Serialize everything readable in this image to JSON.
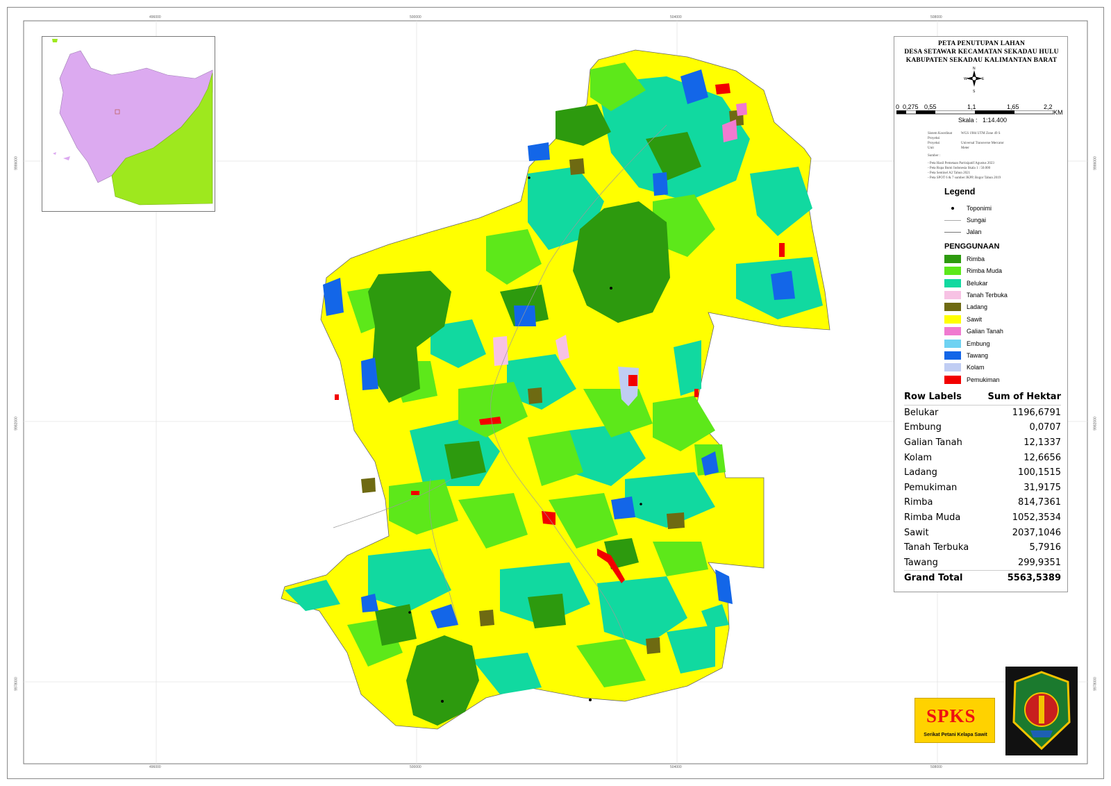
{
  "map": {
    "title_lines": [
      "PETA PENUTUPAN LAHAN",
      "DESA SETAWAR KECAMATAN SEKADAU HULU",
      "KABUPATEN SEKADAU KALIMANTAN BARAT"
    ],
    "north_arrow": {
      "n": "N",
      "s": "S",
      "e": "E",
      "w": "W"
    },
    "scale_labels": [
      "0",
      "0,275",
      "0,55",
      "1,1",
      "1,65",
      "2,2"
    ],
    "scale_unit": "KM",
    "scale_text": "Skala :",
    "scale_value": "1:14.400",
    "coordinate_system": [
      {
        "k": "Sistem Koordinat Proyeksi",
        "v": "WGS 1984 UTM Zone 49 S"
      },
      {
        "k": "Proyeksi",
        "v": "Universal Transverse Mercator"
      },
      {
        "k": "Unit",
        "v": "Meter"
      }
    ],
    "sources_title": "Sumber :",
    "sources": [
      "- Peta Hasil Pemetaan Partisipatif Agustus 2023",
      "- Peta Rupa Bumi Indonesia Skala 1 : 50.000",
      "- Peta Sentinel A2 Tahun 2021",
      "- Peta SPOT 6 & 7 sumber JKPP, Bogor Tahun 2019"
    ],
    "grid_labels_top": [
      "496000",
      "500000",
      "504000",
      "508000"
    ],
    "grid_labels_side": [
      "9986000",
      "9982000",
      "9978000"
    ]
  },
  "legend": {
    "title": "Legend",
    "symbols": [
      {
        "label": "Toponimi",
        "icon": "point-icon"
      },
      {
        "label": "Sungai",
        "icon": "river-line-icon"
      },
      {
        "label": "Jalan",
        "icon": "road-line-icon"
      }
    ],
    "section_title": "PENGGUNAAN",
    "classes": [
      {
        "label": "Rimba",
        "color": "#2d9a0e"
      },
      {
        "label": "Rimba Muda",
        "color": "#5de81a"
      },
      {
        "label": "Belukar",
        "color": "#11d9a0"
      },
      {
        "label": "Tanah Terbuka",
        "color": "#f7c2e4"
      },
      {
        "label": "Ladang",
        "color": "#6e6a12"
      },
      {
        "label": "Sawit",
        "color": "#ffff00"
      },
      {
        "label": "Galian Tanah",
        "color": "#f07ad0"
      },
      {
        "label": "Embung",
        "color": "#6fd2f2"
      },
      {
        "label": "Tawang",
        "color": "#1366e8"
      },
      {
        "label": "Kolam",
        "color": "#c0cdf3"
      },
      {
        "label": "Pemukiman",
        "color": "#f20000"
      }
    ]
  },
  "stats": {
    "header": {
      "label": "Row Labels",
      "value": "Sum of Hektar"
    },
    "rows": [
      {
        "label": "Belukar",
        "value": "1196,6791"
      },
      {
        "label": "Embung",
        "value": "0,0707"
      },
      {
        "label": "Galian Tanah",
        "value": "12,1337"
      },
      {
        "label": "Kolam",
        "value": "12,6656"
      },
      {
        "label": "Ladang",
        "value": "100,1515"
      },
      {
        "label": "Pemukiman",
        "value": "31,9175"
      },
      {
        "label": "Rimba",
        "value": "814,7361"
      },
      {
        "label": "Rimba Muda",
        "value": "1052,3534"
      },
      {
        "label": "Sawit",
        "value": "2037,1046"
      },
      {
        "label": "Tanah Terbuka",
        "value": "5,7916"
      },
      {
        "label": "Tawang",
        "value": "299,9351"
      }
    ],
    "total": {
      "label": "Grand Total",
      "value": "5563,5389"
    }
  },
  "logos": {
    "spks_mark": "SPKS",
    "spks_name": "Serikat Petani Kelapa Sawit"
  }
}
